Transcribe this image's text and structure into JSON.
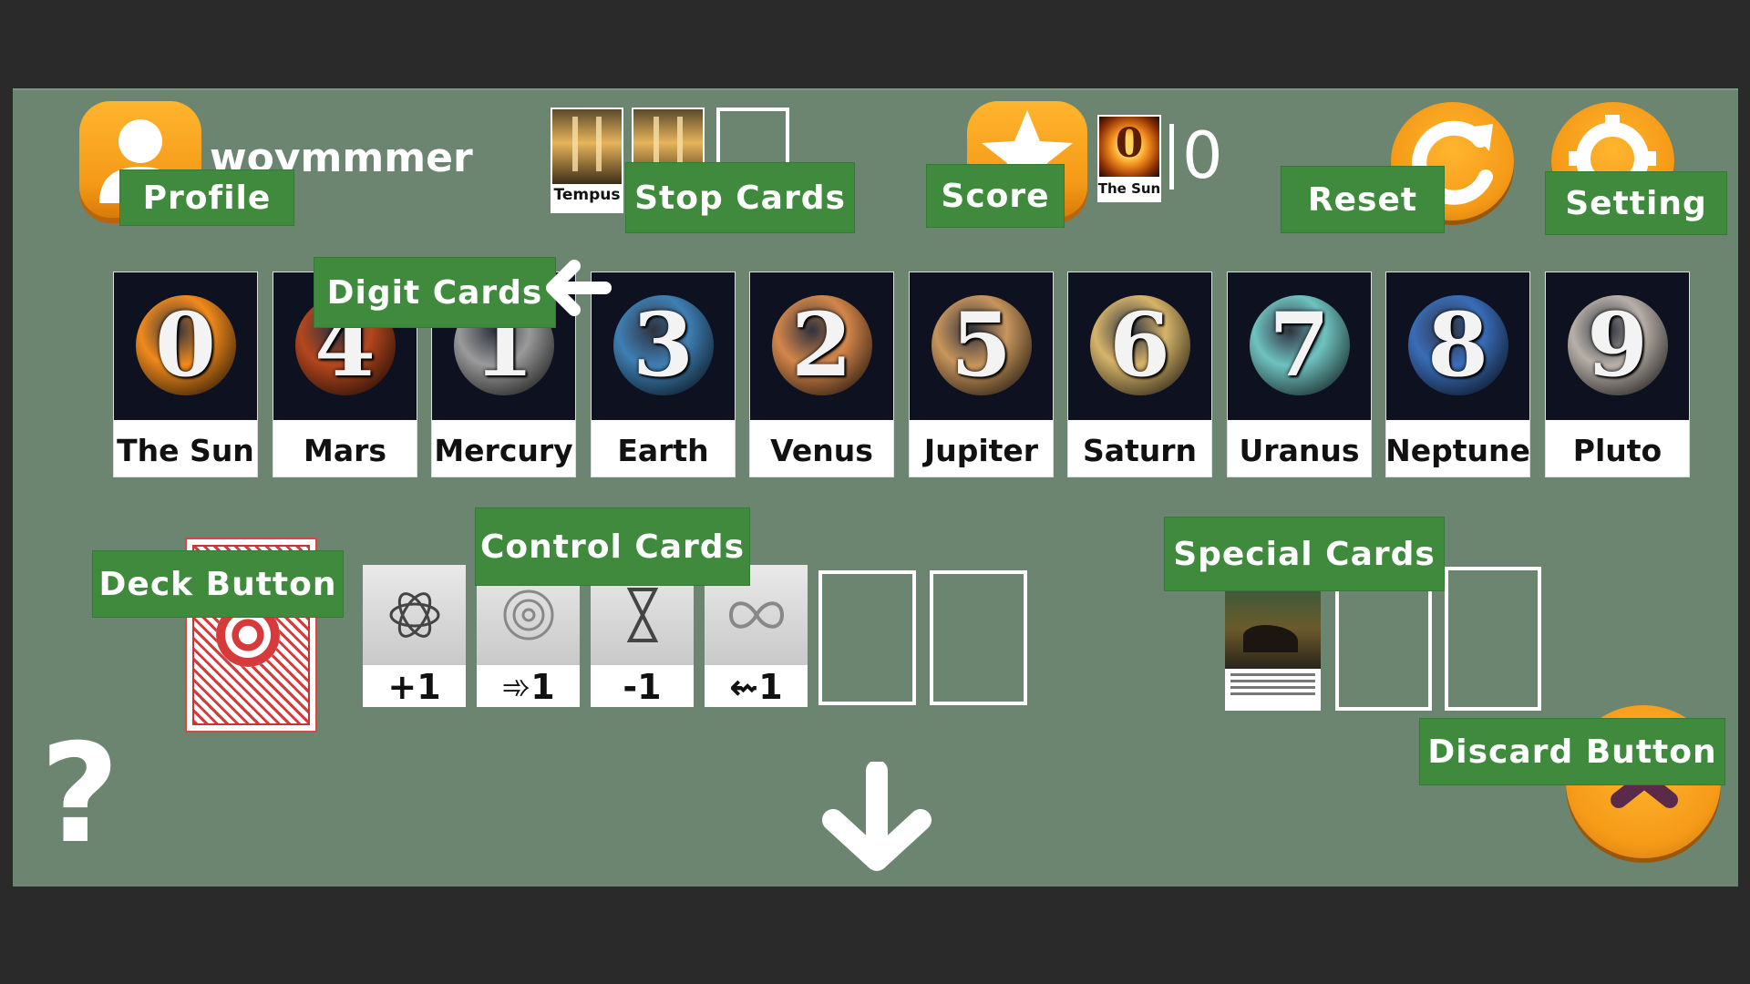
{
  "header": {
    "username": "woymmmer",
    "score_value": "0",
    "score_card_digit": "0",
    "score_card_caption": "The Sun",
    "stop_cards": [
      {
        "caption": "Tempus"
      },
      {
        "caption": ""
      }
    ]
  },
  "labels": {
    "profile": "Profile",
    "stop_cards": "Stop Cards",
    "score": "Score",
    "reset": "Reset",
    "setting": "Setting",
    "digit_cards": "Digit Cards",
    "control_cards": "Control Cards",
    "special_cards": "Special Cards",
    "deck_button": "Deck Button",
    "discard_button": "Discard Button"
  },
  "digit_cards": [
    {
      "digit": "0",
      "name": "The Sun",
      "color": "#f08a1c"
    },
    {
      "digit": "4",
      "name": "Mars",
      "color": "#b4471e"
    },
    {
      "digit": "1",
      "name": "Mercury",
      "color": "#9a9a9a"
    },
    {
      "digit": "3",
      "name": "Earth",
      "color": "#3f7fb4"
    },
    {
      "digit": "2",
      "name": "Venus",
      "color": "#d4864a"
    },
    {
      "digit": "5",
      "name": "Jupiter",
      "color": "#c8955c"
    },
    {
      "digit": "6",
      "name": "Saturn",
      "color": "#d6b46a"
    },
    {
      "digit": "7",
      "name": "Uranus",
      "color": "#6fc2c0"
    },
    {
      "digit": "8",
      "name": "Neptune",
      "color": "#3a6db8"
    },
    {
      "digit": "9",
      "name": "Pluto",
      "color": "#b8b0a8"
    }
  ],
  "control_cards": [
    {
      "value": "+1",
      "icon": "atom-icon"
    },
    {
      "value": "➾1",
      "icon": "spiral-icon"
    },
    {
      "value": "-1",
      "icon": "hourglass-icon"
    },
    {
      "value": "⇜1",
      "icon": "infinity-icon"
    }
  ],
  "help": {
    "glyph": "?"
  },
  "colors": {
    "board": "#6b8570",
    "label_bg": "#3f8a3d",
    "button_orange": "#f59a17",
    "background": "#2a2a2a"
  }
}
